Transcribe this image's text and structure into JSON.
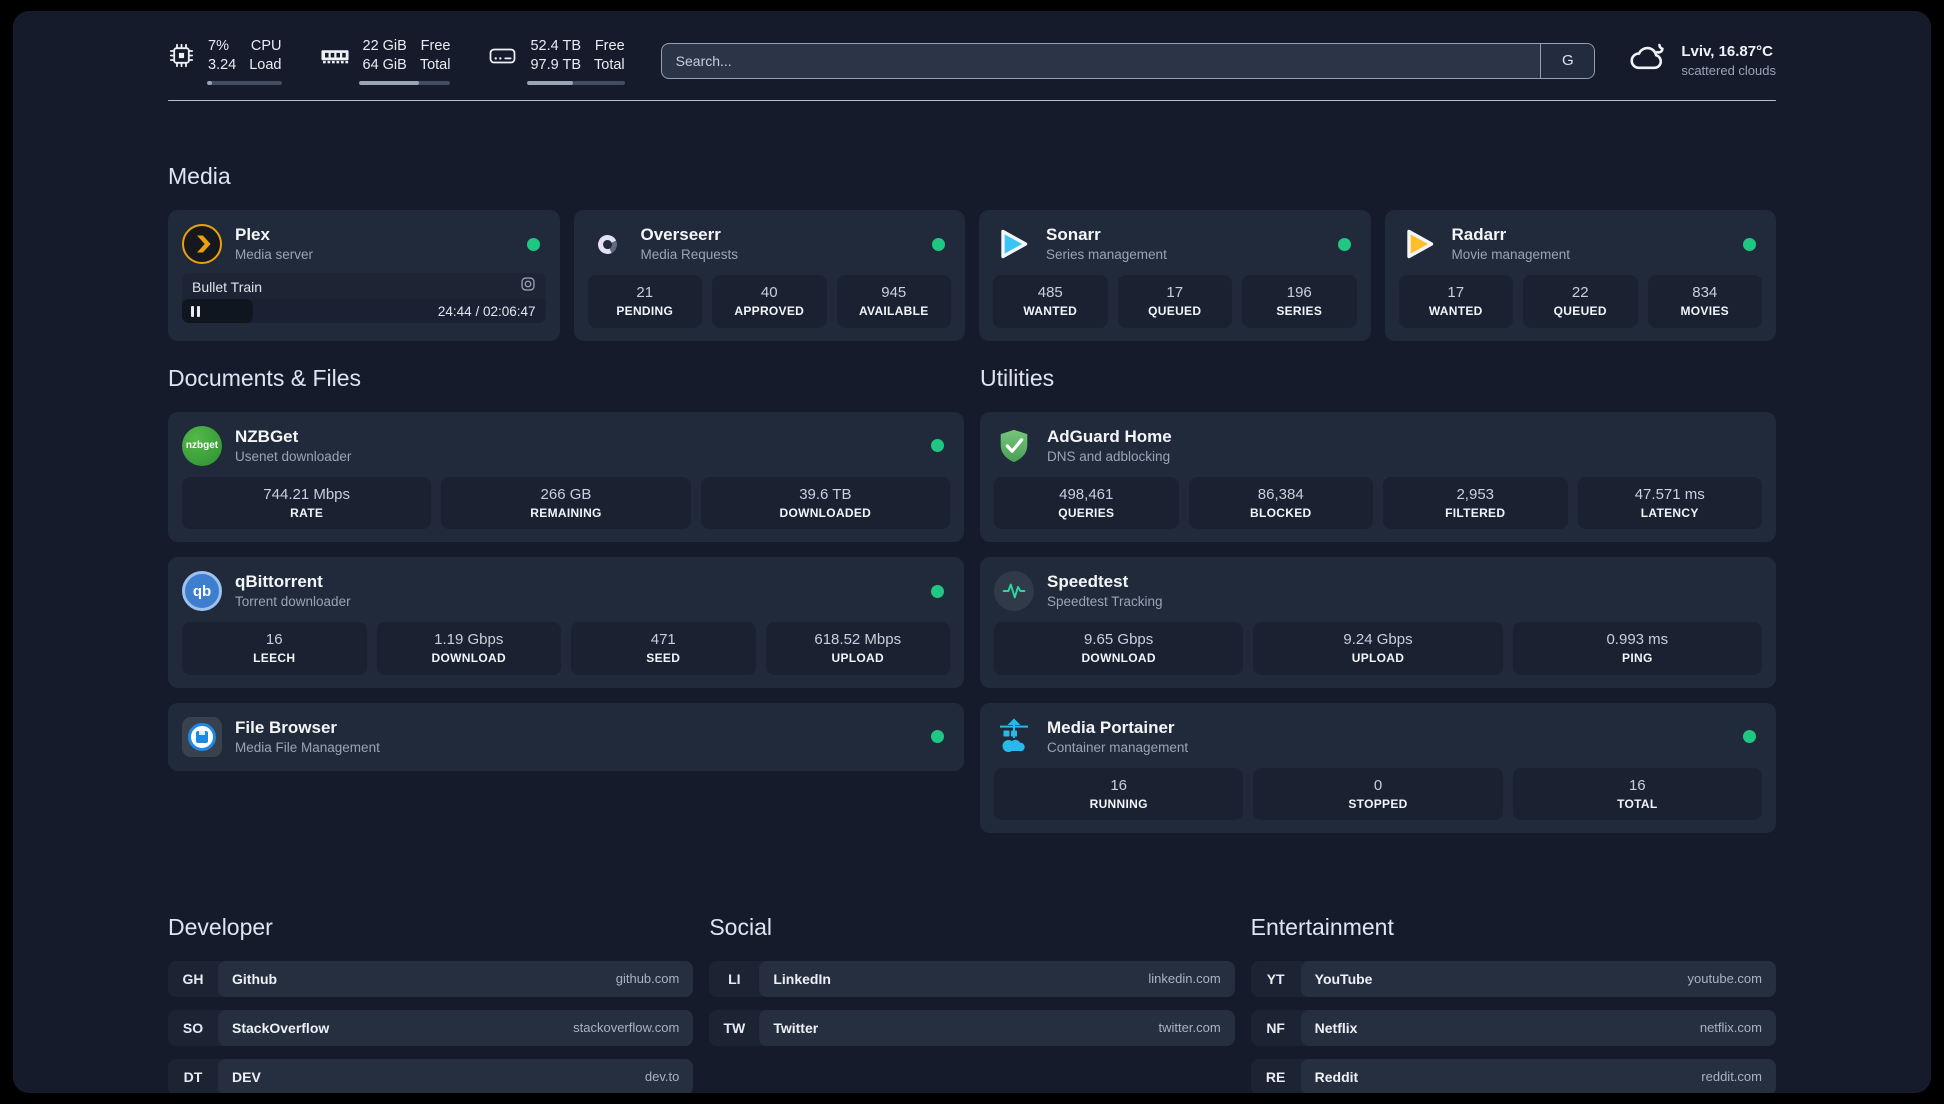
{
  "titles": {
    "media": "Media",
    "documents": "Documents & Files",
    "utilities": "Utilities",
    "developer": "Developer",
    "social": "Social",
    "entertainment": "Entertainment"
  },
  "header": {
    "cpu": {
      "line1": "7%",
      "line2": "3.24",
      "label1": "CPU",
      "label2": "Load",
      "progress_pct": 7
    },
    "memory": {
      "line1": "22 GiB",
      "line2": "64 GiB",
      "label1": "Free",
      "label2": "Total",
      "progress_pct": 66
    },
    "disk": {
      "line1": "52.4 TB",
      "line2": "97.9 TB",
      "label1": "Free",
      "label2": "Total",
      "progress_pct": 47
    },
    "search": {
      "placeholder": "Search...",
      "engine_button": "G"
    },
    "weather": {
      "location": "Lviv, 16.87°C",
      "condition": "scattered clouds"
    }
  },
  "apps": {
    "plex": {
      "name": "Plex",
      "desc": "Media server",
      "player": {
        "title": "Bullet Train",
        "time": "24:44 / 02:06:47",
        "progress_pct": 19.5
      }
    },
    "overseerr": {
      "name": "Overseerr",
      "desc": "Media Requests",
      "stats": [
        {
          "value": "21",
          "label": "PENDING"
        },
        {
          "value": "40",
          "label": "APPROVED"
        },
        {
          "value": "945",
          "label": "AVAILABLE"
        }
      ]
    },
    "sonarr": {
      "name": "Sonarr",
      "desc": "Series management",
      "stats": [
        {
          "value": "485",
          "label": "WANTED"
        },
        {
          "value": "17",
          "label": "QUEUED"
        },
        {
          "value": "196",
          "label": "SERIES"
        }
      ]
    },
    "radarr": {
      "name": "Radarr",
      "desc": "Movie management",
      "stats": [
        {
          "value": "17",
          "label": "WANTED"
        },
        {
          "value": "22",
          "label": "QUEUED"
        },
        {
          "value": "834",
          "label": "MOVIES"
        }
      ]
    },
    "nzbget": {
      "name": "NZBGet",
      "desc": "Usenet downloader",
      "icon_text": "nzbget",
      "stats": [
        {
          "value": "744.21 Mbps",
          "label": "RATE"
        },
        {
          "value": "266 GB",
          "label": "REMAINING"
        },
        {
          "value": "39.6 TB",
          "label": "DOWNLOADED"
        }
      ]
    },
    "qbittorrent": {
      "name": "qBittorrent",
      "desc": "Torrent downloader",
      "icon_text": "qb",
      "stats": [
        {
          "value": "16",
          "label": "LEECH"
        },
        {
          "value": "1.19 Gbps",
          "label": "DOWNLOAD"
        },
        {
          "value": "471",
          "label": "SEED"
        },
        {
          "value": "618.52 Mbps",
          "label": "UPLOAD"
        }
      ]
    },
    "filebrowser": {
      "name": "File Browser",
      "desc": "Media File Management"
    },
    "adguard": {
      "name": "AdGuard Home",
      "desc": "DNS and adblocking",
      "stats": [
        {
          "value": "498,461",
          "label": "QUERIES"
        },
        {
          "value": "86,384",
          "label": "BLOCKED"
        },
        {
          "value": "2,953",
          "label": "FILTERED"
        },
        {
          "value": "47.571 ms",
          "label": "LATENCY"
        }
      ]
    },
    "speedtest": {
      "name": "Speedtest",
      "desc": "Speedtest Tracking",
      "stats": [
        {
          "value": "9.65 Gbps",
          "label": "DOWNLOAD"
        },
        {
          "value": "9.24 Gbps",
          "label": "UPLOAD"
        },
        {
          "value": "0.993 ms",
          "label": "PING"
        }
      ]
    },
    "portainer": {
      "name": "Media Portainer",
      "desc": "Container management",
      "stats": [
        {
          "value": "16",
          "label": "RUNNING"
        },
        {
          "value": "0",
          "label": "STOPPED"
        },
        {
          "value": "16",
          "label": "TOTAL"
        }
      ]
    }
  },
  "links": {
    "developer": [
      {
        "tag": "GH",
        "name": "Github",
        "url": "github.com"
      },
      {
        "tag": "SO",
        "name": "StackOverflow",
        "url": "stackoverflow.com"
      },
      {
        "tag": "DT",
        "name": "DEV",
        "url": "dev.to"
      }
    ],
    "social": [
      {
        "tag": "LI",
        "name": "LinkedIn",
        "url": "linkedin.com"
      },
      {
        "tag": "TW",
        "name": "Twitter",
        "url": "twitter.com"
      }
    ],
    "entertainment": [
      {
        "tag": "YT",
        "name": "YouTube",
        "url": "youtube.com"
      },
      {
        "tag": "NF",
        "name": "Netflix",
        "url": "netflix.com"
      },
      {
        "tag": "RE",
        "name": "Reddit",
        "url": "reddit.com"
      }
    ]
  },
  "colors": {
    "status_online": "#1fc783",
    "plex_accent": "#e9a20e",
    "sonarr_accent": "#38c5f4",
    "radarr_accent": "#ffbe2a",
    "adguard_accent": "#5cb464",
    "portainer_accent": "#28b9ea",
    "speedtest_accent": "#2fd6a2"
  }
}
